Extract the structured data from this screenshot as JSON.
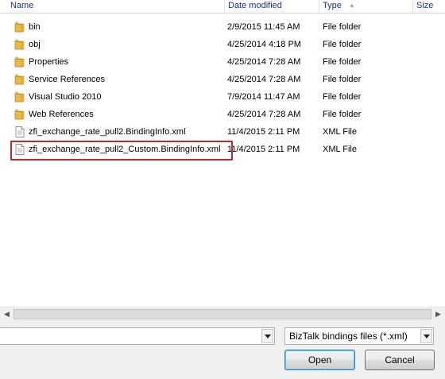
{
  "columns": {
    "name": "Name",
    "date_modified": "Date modified",
    "type": "Type",
    "size": "Size"
  },
  "files": [
    {
      "name": "bin",
      "date": "2/9/2015 11:45 AM",
      "type": "File folder",
      "icon": "folder-icon"
    },
    {
      "name": "obj",
      "date": "4/25/2014 4:18 PM",
      "type": "File folder",
      "icon": "folder-icon"
    },
    {
      "name": "Properties",
      "date": "4/25/2014 7:28 AM",
      "type": "File folder",
      "icon": "folder-icon"
    },
    {
      "name": "Service References",
      "date": "4/25/2014 7:28 AM",
      "type": "File folder",
      "icon": "folder-icon"
    },
    {
      "name": "Visual Studio 2010",
      "date": "7/9/2014 11:47 AM",
      "type": "File folder",
      "icon": "folder-icon"
    },
    {
      "name": "Web References",
      "date": "4/25/2014 7:28 AM",
      "type": "File folder",
      "icon": "folder-icon"
    },
    {
      "name": "zfi_exchange_rate_pull2.BindingInfo.xml",
      "date": "11/4/2015 2:11 PM",
      "type": "XML File",
      "icon": "xml-file-icon"
    },
    {
      "name": "zfi_exchange_rate_pull2_Custom.BindingInfo.xml",
      "date": "11/4/2015 2:11 PM",
      "type": "XML File",
      "icon": "xml-file-icon"
    }
  ],
  "file_name_input": {
    "value": ""
  },
  "file_type_filter": {
    "value": "BizTalk bindings files (*.xml)"
  },
  "buttons": {
    "open": "Open",
    "cancel": "Cancel"
  },
  "colors": {
    "highlight": "#c0282d",
    "folder": "#e8b94a",
    "header_text": "#1e3287"
  }
}
